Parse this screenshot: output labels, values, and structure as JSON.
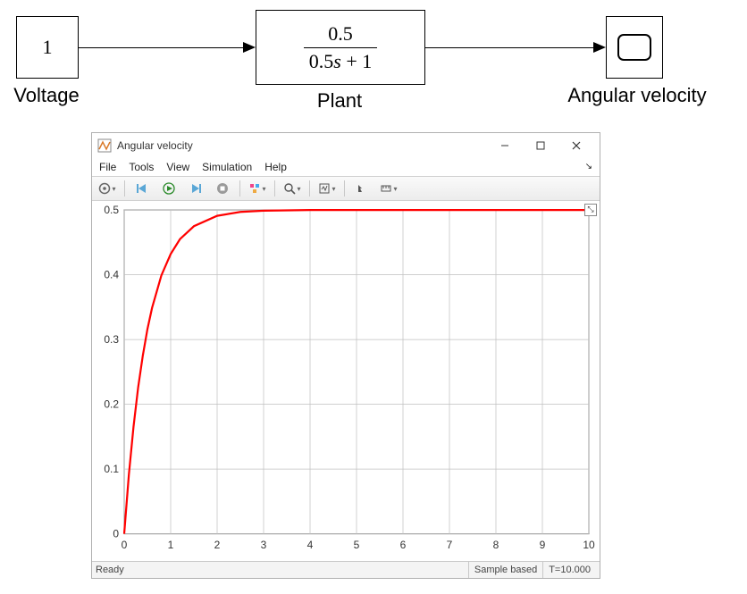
{
  "diagram": {
    "blocks": {
      "voltage": {
        "value": "1",
        "label": "Voltage"
      },
      "plant": {
        "numerator": "0.5",
        "denominator_pre": "0.5",
        "denominator_var": "s",
        "denominator_post": " + 1",
        "label": "Plant"
      },
      "scope": {
        "label": "Angular velocity"
      }
    }
  },
  "scope_window": {
    "title": "Angular velocity",
    "menus": {
      "file": "File",
      "tools": "Tools",
      "view": "View",
      "simulation": "Simulation",
      "help": "Help"
    },
    "status": {
      "ready": "Ready",
      "sample": "Sample based",
      "time": "T=10.000"
    },
    "zoom_badge": "⤡"
  },
  "chart_data": {
    "type": "line",
    "title": "",
    "xlabel": "",
    "ylabel": "",
    "xlim": [
      0,
      10
    ],
    "ylim": [
      0,
      0.5
    ],
    "xticks": [
      0,
      1,
      2,
      3,
      4,
      5,
      6,
      7,
      8,
      9,
      10
    ],
    "yticks": [
      0,
      0.1,
      0.2,
      0.3,
      0.4,
      0.5
    ],
    "series": [
      {
        "name": "Angular velocity",
        "color": "#ff0000",
        "x": [
          0,
          0.1,
          0.2,
          0.3,
          0.4,
          0.5,
          0.6,
          0.8,
          1.0,
          1.2,
          1.5,
          2.0,
          2.5,
          3.0,
          4.0,
          5.0,
          6.0,
          7.0,
          8.0,
          9.0,
          10.0
        ],
        "y": [
          0,
          0.091,
          0.165,
          0.226,
          0.275,
          0.316,
          0.349,
          0.399,
          0.432,
          0.455,
          0.475,
          0.491,
          0.497,
          0.499,
          0.5,
          0.5,
          0.5,
          0.5,
          0.5,
          0.5,
          0.5
        ]
      }
    ]
  }
}
